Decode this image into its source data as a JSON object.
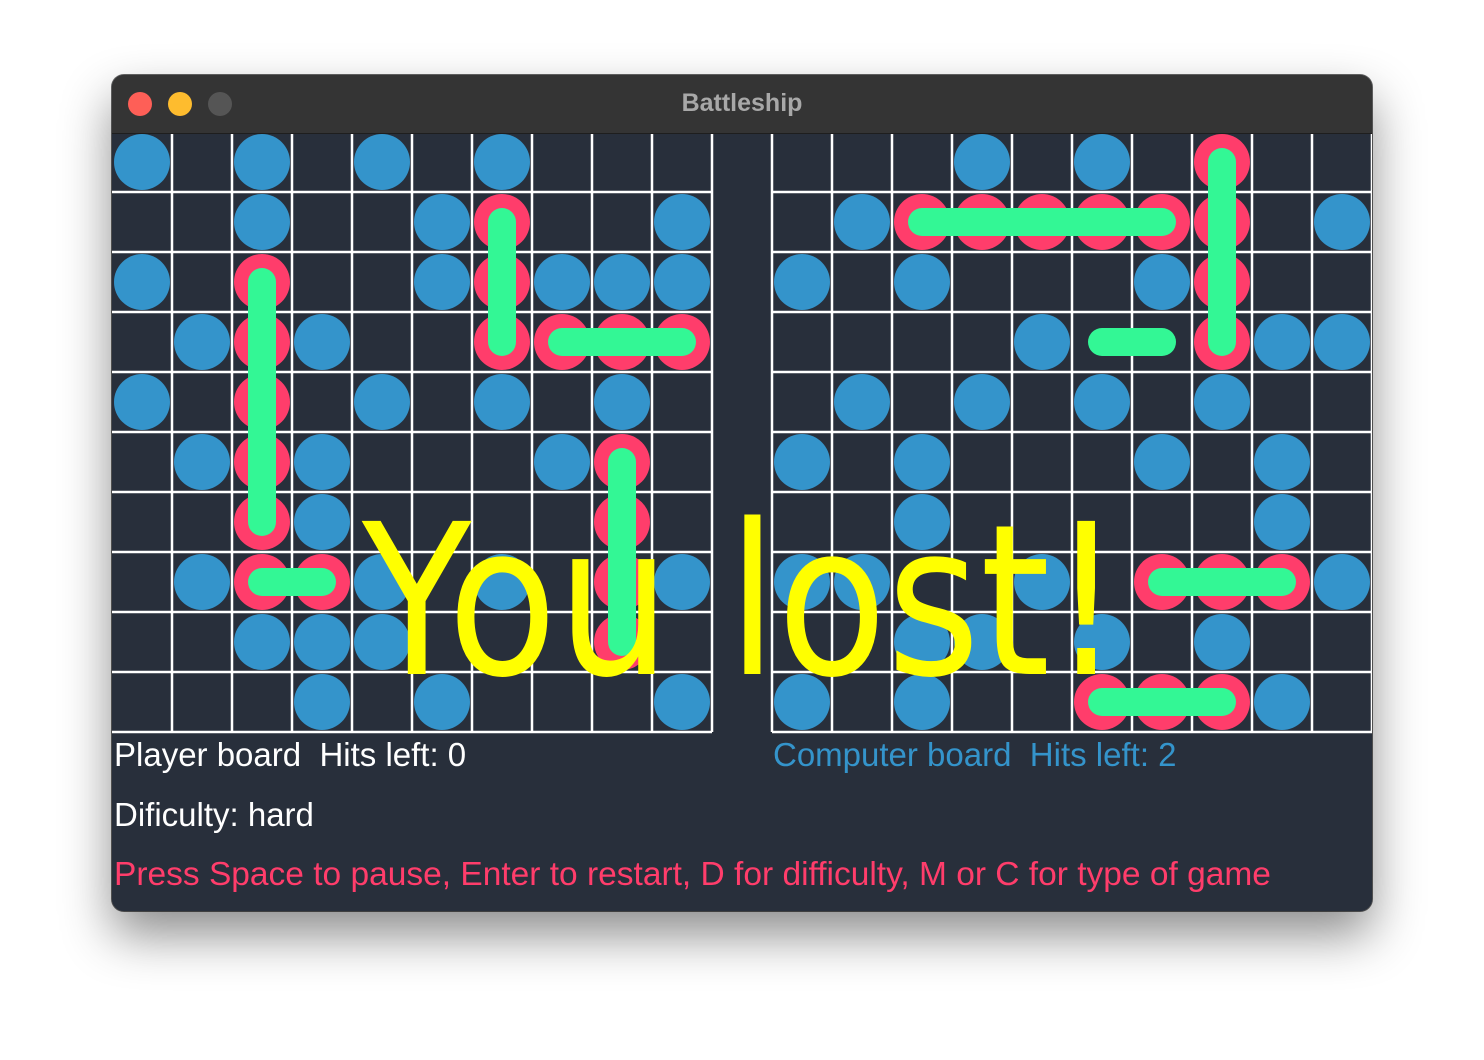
{
  "window": {
    "title": "Battleship"
  },
  "colors": {
    "background": "#282f3b",
    "grid": "#ffffff",
    "miss": "#3494cb",
    "hit": "#ff3d6b",
    "ship": "#33f795",
    "overlay_text": "#ffff00",
    "computer_label": "#3494cb",
    "help_text": "#ff3d6b"
  },
  "player_board": {
    "label": "Player board  Hits left: 0",
    "misses": [
      [
        0,
        0
      ],
      [
        2,
        0
      ],
      [
        4,
        0
      ],
      [
        6,
        0
      ],
      [
        2,
        1
      ],
      [
        5,
        1
      ],
      [
        9,
        1
      ],
      [
        0,
        2
      ],
      [
        5,
        2
      ],
      [
        7,
        2
      ],
      [
        8,
        2
      ],
      [
        9,
        2
      ],
      [
        1,
        3
      ],
      [
        3,
        3
      ],
      [
        0,
        4
      ],
      [
        4,
        4
      ],
      [
        6,
        4
      ],
      [
        8,
        4
      ],
      [
        1,
        5
      ],
      [
        3,
        5
      ],
      [
        7,
        5
      ],
      [
        3,
        6
      ],
      [
        1,
        7
      ],
      [
        4,
        7
      ],
      [
        6,
        7
      ],
      [
        9,
        7
      ],
      [
        2,
        8
      ],
      [
        3,
        8
      ],
      [
        4,
        8
      ],
      [
        3,
        9
      ],
      [
        5,
        9
      ],
      [
        9,
        9
      ]
    ],
    "hits": [
      [
        2,
        2
      ],
      [
        2,
        3
      ],
      [
        2,
        4
      ],
      [
        2,
        5
      ],
      [
        2,
        6
      ],
      [
        2,
        7
      ],
      [
        3,
        7
      ],
      [
        6,
        1
      ],
      [
        6,
        2
      ],
      [
        6,
        3
      ],
      [
        7,
        3
      ],
      [
        8,
        3
      ],
      [
        9,
        3
      ],
      [
        8,
        5
      ],
      [
        8,
        6
      ],
      [
        8,
        7
      ],
      [
        8,
        8
      ]
    ],
    "ships": [
      [
        2,
        2,
        2,
        6
      ],
      [
        2,
        7,
        3,
        7
      ],
      [
        6,
        1,
        6,
        3
      ],
      [
        7,
        3,
        9,
        3
      ],
      [
        8,
        5,
        8,
        8
      ]
    ]
  },
  "computer_board": {
    "label": "Computer board  Hits left: 2",
    "misses": [
      [
        3,
        0
      ],
      [
        5,
        0
      ],
      [
        1,
        1
      ],
      [
        9,
        1
      ],
      [
        0,
        2
      ],
      [
        2,
        2
      ],
      [
        6,
        2
      ],
      [
        4,
        3
      ],
      [
        8,
        3
      ],
      [
        9,
        3
      ],
      [
        1,
        4
      ],
      [
        3,
        4
      ],
      [
        5,
        4
      ],
      [
        7,
        4
      ],
      [
        0,
        5
      ],
      [
        2,
        5
      ],
      [
        6,
        5
      ],
      [
        8,
        5
      ],
      [
        2,
        6
      ],
      [
        8,
        6
      ],
      [
        0,
        7
      ],
      [
        1,
        7
      ],
      [
        4,
        7
      ],
      [
        9,
        7
      ],
      [
        2,
        8
      ],
      [
        3,
        8
      ],
      [
        5,
        8
      ],
      [
        7,
        8
      ],
      [
        0,
        9
      ],
      [
        2,
        9
      ],
      [
        8,
        9
      ]
    ],
    "hits": [
      [
        2,
        1
      ],
      [
        3,
        1
      ],
      [
        4,
        1
      ],
      [
        5,
        1
      ],
      [
        6,
        1
      ],
      [
        7,
        0
      ],
      [
        7,
        1
      ],
      [
        7,
        2
      ],
      [
        7,
        3
      ],
      [
        6,
        7
      ],
      [
        7,
        7
      ],
      [
        8,
        7
      ],
      [
        5,
        9
      ],
      [
        6,
        9
      ],
      [
        7,
        9
      ]
    ],
    "ships": [
      [
        2,
        1,
        6,
        1
      ],
      [
        7,
        0,
        7,
        3
      ],
      [
        5,
        3,
        6,
        3
      ],
      [
        6,
        7,
        8,
        7
      ],
      [
        5,
        9,
        7,
        9
      ]
    ]
  },
  "status": {
    "difficulty": "Dificulty: hard",
    "help": "Press Space to pause, Enter to restart, D for difficulty, M or C for type of game"
  },
  "overlay": {
    "message": "You lost!"
  }
}
